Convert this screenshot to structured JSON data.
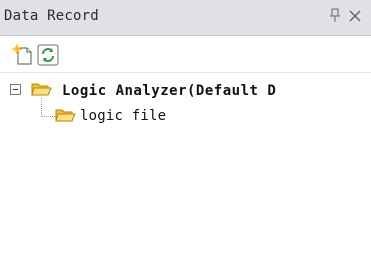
{
  "panel": {
    "title": "Data Record",
    "pin_icon": "pin-icon",
    "close_icon": "close-icon"
  },
  "toolbar": {
    "buttons": [
      {
        "name": "new-item-button",
        "icon": "new-document-sparkle-icon"
      },
      {
        "name": "refresh-button",
        "icon": "refresh-icon"
      }
    ]
  },
  "tree": {
    "root": {
      "label": "Logic Analyzer(Default D",
      "expanded": true,
      "icon": "folder-open-icon"
    },
    "children": [
      {
        "label": "logic file",
        "icon": "folder-open-icon"
      }
    ]
  },
  "colors": {
    "titlebar_bg": "#dfe1e5",
    "folder_yellow": "#f1c232",
    "refresh_green": "#2e9d3f"
  }
}
